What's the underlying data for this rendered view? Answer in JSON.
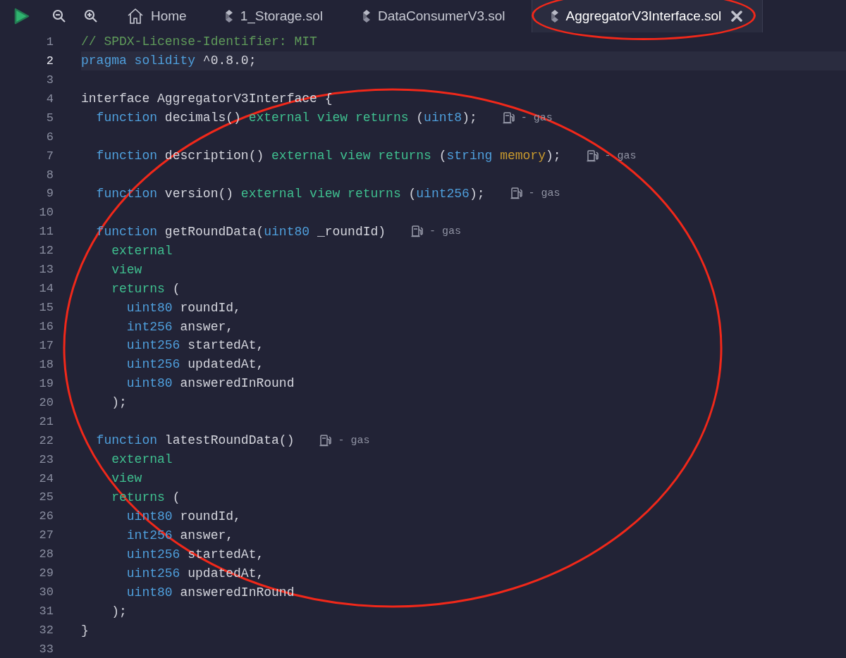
{
  "tabs": [
    {
      "kind": "home",
      "label": "Home",
      "selected": false,
      "circled": false
    },
    {
      "kind": "file",
      "label": "1_Storage.sol",
      "selected": false,
      "circled": false
    },
    {
      "kind": "file",
      "label": "DataConsumerV3.sol",
      "selected": false,
      "circled": false
    },
    {
      "kind": "file",
      "label": "AggregatorV3Interface.sol",
      "selected": true,
      "closable": true,
      "circled": true
    }
  ],
  "editor": {
    "circled": true,
    "lines": [
      {
        "number": "1",
        "current": false,
        "tokens": [
          {
            "text": "// SPDX-License-Identifier: MIT",
            "kind": "comment"
          }
        ]
      },
      {
        "number": "2",
        "current": true,
        "tokens": [
          {
            "text": "pragma solidity",
            "kind": "keyword"
          },
          {
            "text": " ^0.8.0;",
            "kind": "plain"
          }
        ]
      },
      {
        "number": "3",
        "current": false
      },
      {
        "number": "4",
        "current": false,
        "tokens": [
          {
            "text": "interface AggregatorV3Interface {",
            "kind": "plain"
          }
        ]
      },
      {
        "number": "5",
        "current": false,
        "tokens": [
          {
            "text": "  function",
            "kind": "keyword"
          },
          {
            "text": " decimals() ",
            "kind": "plain"
          },
          {
            "text": "external view returns",
            "kind": "modifier"
          },
          {
            "text": " (",
            "kind": "plain"
          },
          {
            "text": "uint8",
            "kind": "keyword"
          },
          {
            "text": ");",
            "kind": "plain"
          }
        ],
        "hint": "- gas"
      },
      {
        "number": "6",
        "current": false
      },
      {
        "number": "7",
        "current": false,
        "tokens": [
          {
            "text": "  function",
            "kind": "keyword"
          },
          {
            "text": " description() ",
            "kind": "plain"
          },
          {
            "text": "external view returns",
            "kind": "modifier"
          },
          {
            "text": " (",
            "kind": "plain"
          },
          {
            "text": "string",
            "kind": "keyword"
          },
          {
            "text": " memory",
            "kind": "storage"
          },
          {
            "text": ");",
            "kind": "plain"
          }
        ],
        "hint": "- gas"
      },
      {
        "number": "8",
        "current": false
      },
      {
        "number": "9",
        "current": false,
        "tokens": [
          {
            "text": "  function",
            "kind": "keyword"
          },
          {
            "text": " version() ",
            "kind": "plain"
          },
          {
            "text": "external view returns",
            "kind": "modifier"
          },
          {
            "text": " (",
            "kind": "plain"
          },
          {
            "text": "uint256",
            "kind": "keyword"
          },
          {
            "text": ");",
            "kind": "plain"
          }
        ],
        "hint": "- gas"
      },
      {
        "number": "10",
        "current": false
      },
      {
        "number": "11",
        "current": false,
        "tokens": [
          {
            "text": "  function",
            "kind": "keyword"
          },
          {
            "text": " getRoundData(",
            "kind": "plain"
          },
          {
            "text": "uint80",
            "kind": "keyword"
          },
          {
            "text": " _roundId)",
            "kind": "plain"
          }
        ],
        "hint": "- gas"
      },
      {
        "number": "12",
        "current": false,
        "tokens": [
          {
            "text": "    external",
            "kind": "modifier"
          }
        ]
      },
      {
        "number": "13",
        "current": false,
        "tokens": [
          {
            "text": "    view",
            "kind": "modifier"
          }
        ]
      },
      {
        "number": "14",
        "current": false,
        "tokens": [
          {
            "text": "    returns",
            "kind": "modifier"
          },
          {
            "text": " (",
            "kind": "plain"
          }
        ]
      },
      {
        "number": "15",
        "current": false,
        "tokens": [
          {
            "text": "      uint80",
            "kind": "keyword"
          },
          {
            "text": " roundId,",
            "kind": "plain"
          }
        ]
      },
      {
        "number": "16",
        "current": false,
        "tokens": [
          {
            "text": "      int256",
            "kind": "keyword"
          },
          {
            "text": " answer,",
            "kind": "plain"
          }
        ]
      },
      {
        "number": "17",
        "current": false,
        "tokens": [
          {
            "text": "      uint256",
            "kind": "keyword"
          },
          {
            "text": " startedAt,",
            "kind": "plain"
          }
        ]
      },
      {
        "number": "18",
        "current": false,
        "tokens": [
          {
            "text": "      uint256",
            "kind": "keyword"
          },
          {
            "text": " updatedAt,",
            "kind": "plain"
          }
        ]
      },
      {
        "number": "19",
        "current": false,
        "tokens": [
          {
            "text": "      uint80",
            "kind": "keyword"
          },
          {
            "text": " answeredInRound",
            "kind": "plain"
          }
        ]
      },
      {
        "number": "20",
        "current": false,
        "tokens": [
          {
            "text": "    );",
            "kind": "plain"
          }
        ]
      },
      {
        "number": "21",
        "current": false
      },
      {
        "number": "22",
        "current": false,
        "tokens": [
          {
            "text": "  function",
            "kind": "keyword"
          },
          {
            "text": " latestRoundData()",
            "kind": "plain"
          }
        ],
        "hint": "- gas"
      },
      {
        "number": "23",
        "current": false,
        "tokens": [
          {
            "text": "    external",
            "kind": "modifier"
          }
        ]
      },
      {
        "number": "24",
        "current": false,
        "tokens": [
          {
            "text": "    view",
            "kind": "modifier"
          }
        ]
      },
      {
        "number": "25",
        "current": false,
        "tokens": [
          {
            "text": "    returns",
            "kind": "modifier"
          },
          {
            "text": " (",
            "kind": "plain"
          }
        ]
      },
      {
        "number": "26",
        "current": false,
        "tokens": [
          {
            "text": "      uint80",
            "kind": "keyword"
          },
          {
            "text": " roundId,",
            "kind": "plain"
          }
        ]
      },
      {
        "number": "27",
        "current": false,
        "tokens": [
          {
            "text": "      int256",
            "kind": "keyword"
          },
          {
            "text": " answer,",
            "kind": "plain"
          }
        ]
      },
      {
        "number": "28",
        "current": false,
        "tokens": [
          {
            "text": "      uint256",
            "kind": "keyword"
          },
          {
            "text": " startedAt,",
            "kind": "plain"
          }
        ]
      },
      {
        "number": "29",
        "current": false,
        "tokens": [
          {
            "text": "      uint256",
            "kind": "keyword"
          },
          {
            "text": " updatedAt,",
            "kind": "plain"
          }
        ]
      },
      {
        "number": "30",
        "current": false,
        "tokens": [
          {
            "text": "      uint80",
            "kind": "keyword"
          },
          {
            "text": " answeredInRound",
            "kind": "plain"
          }
        ]
      },
      {
        "number": "31",
        "current": false,
        "tokens": [
          {
            "text": "    );",
            "kind": "plain"
          }
        ]
      },
      {
        "number": "32",
        "current": false,
        "tokens": [
          {
            "text": "}",
            "kind": "plain"
          }
        ]
      },
      {
        "number": "33",
        "current": false
      }
    ]
  }
}
